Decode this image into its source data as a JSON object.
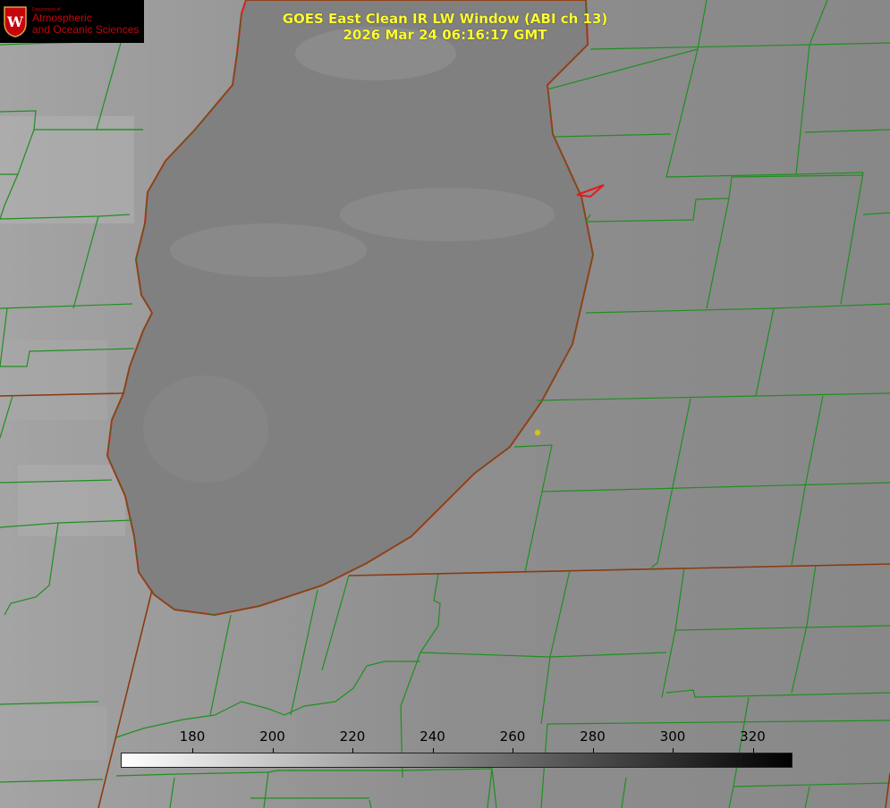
{
  "title": {
    "line1": "GOES East Clean IR LW Window (ABI ch 13)",
    "line2": "2026 Mar 24 06:16:17 GMT"
  },
  "logo": {
    "icon": "uw-crest-icon",
    "dept": "Department of",
    "line1": "Atmospheric",
    "line2": "and Oceanic Sciences",
    "color": "#c5050c"
  },
  "colorbar": {
    "ticks": [
      "180",
      "200",
      "220",
      "240",
      "260",
      "280",
      "300",
      "320"
    ],
    "scale": "white-to-black"
  },
  "colors": {
    "county_lines": "#1f8f1f",
    "state_lines": "#8a3b12",
    "lake_outline": "#e41a1c",
    "marker": "#d4c21a",
    "title": "#ffff33"
  }
}
